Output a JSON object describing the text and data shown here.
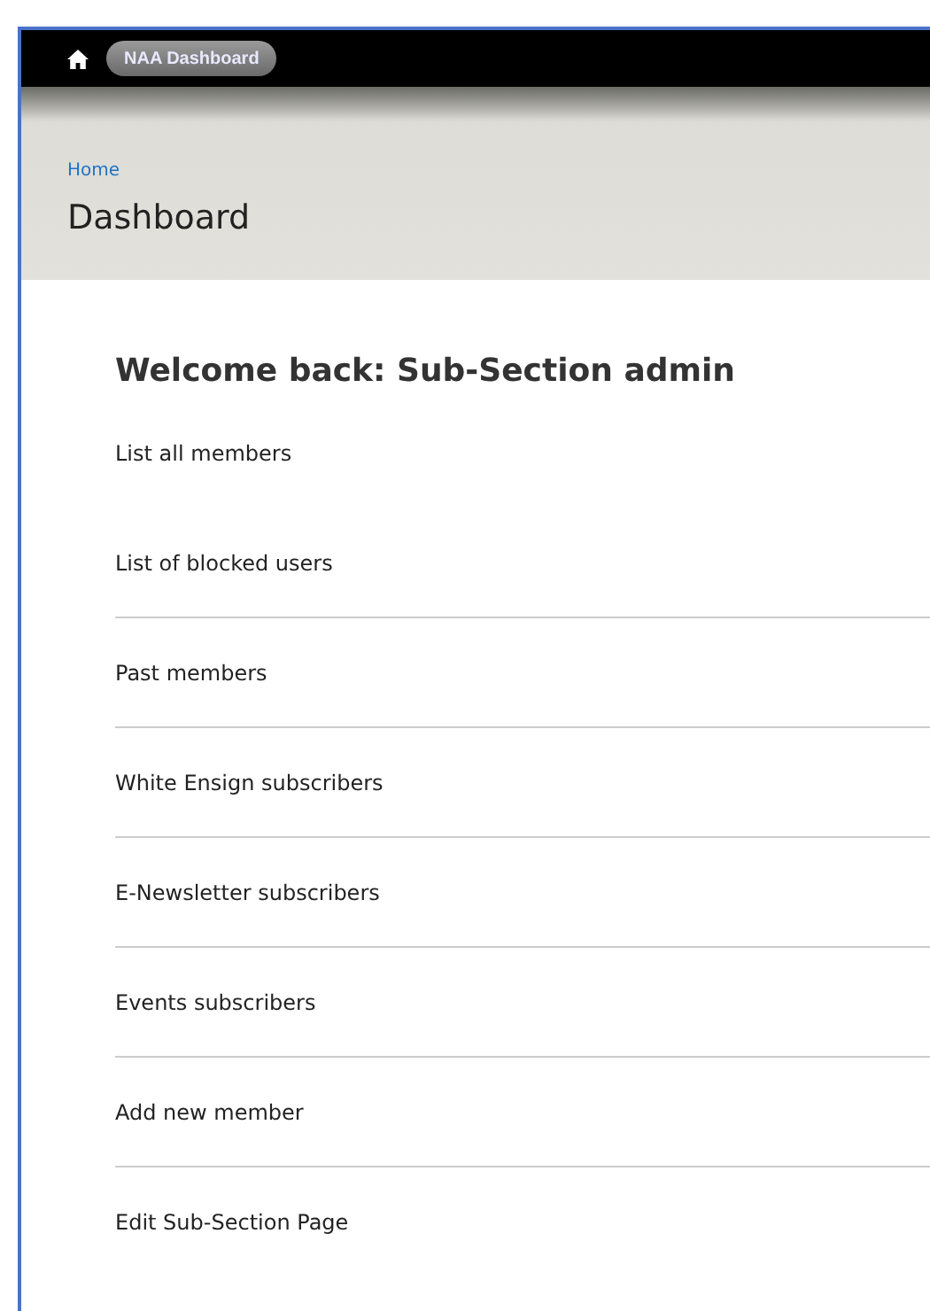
{
  "top_bar": {
    "home_label": "NAA Dashboard"
  },
  "header": {
    "breadcrumb": "Home",
    "title": "Dashboard"
  },
  "welcome": "Welcome back: Sub-Section admin",
  "links": [
    {
      "label": "List all members",
      "divider_above": false
    },
    {
      "label": "List of blocked users",
      "divider_above": false
    },
    {
      "label": "Past members",
      "divider_above": true
    },
    {
      "label": "White Ensign subscribers",
      "divider_above": true
    },
    {
      "label": "E-Newsletter subscribers",
      "divider_above": true
    },
    {
      "label": "Events subscribers",
      "divider_above": true
    },
    {
      "label": "Add new member",
      "divider_above": true
    },
    {
      "label": "Edit Sub-Section Page",
      "divider_above": true
    }
  ]
}
